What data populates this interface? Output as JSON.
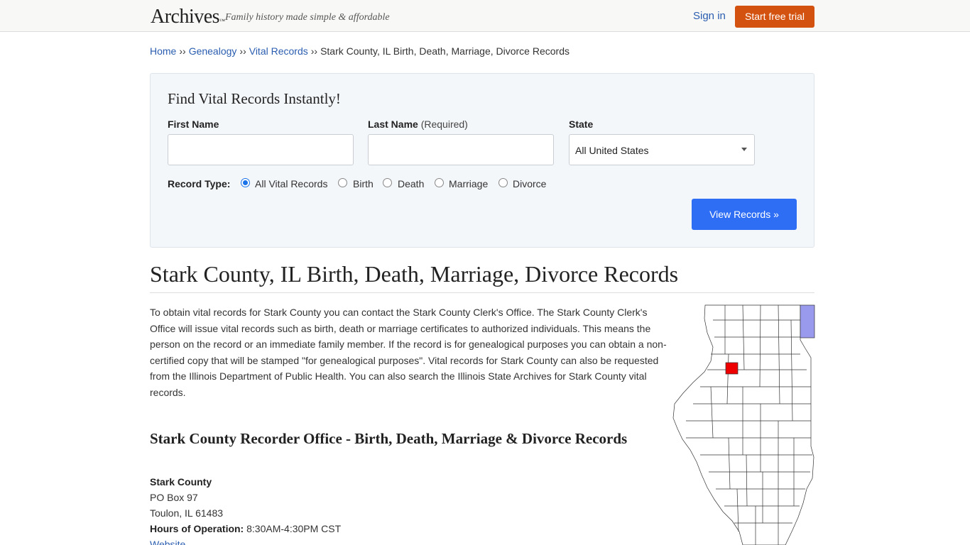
{
  "header": {
    "logo": "Archives",
    "logo_tm": "™",
    "tagline": "Family history made simple & affordable",
    "signin": "Sign in",
    "trial": "Start free trial"
  },
  "breadcrumb": {
    "items": [
      "Home",
      "Genealogy",
      "Vital Records"
    ],
    "separator": "››",
    "current": "Stark County, IL Birth, Death, Marriage, Divorce Records"
  },
  "search": {
    "title": "Find Vital Records Instantly!",
    "first_name_label": "First Name",
    "last_name_label": "Last Name",
    "last_name_required": "(Required)",
    "state_label": "State",
    "state_value": "All United States",
    "record_type_label": "Record Type:",
    "record_types": [
      "All Vital Records",
      "Birth",
      "Death",
      "Marriage",
      "Divorce"
    ],
    "selected_record_type": "All Vital Records",
    "submit": "View Records »"
  },
  "page_title": "Stark County, IL Birth, Death, Marriage, Divorce Records",
  "intro": "To obtain vital records for Stark County you can contact the Stark County Clerk's Office. The Stark County Clerk's Office will issue vital records such as birth, death or marriage certificates to authorized individuals. This means the person on the record or an immediate family member. If the record is for genealogical purposes you can obtain a non-certified copy that will be stamped \"for genealogical purposes\". Vital records for Stark County can also be requested from the Illinois Department of Public Health. You can also search the Illinois State Archives for Stark County vital records.",
  "section_title": "Stark County Recorder Office - Birth, Death, Marriage & Divorce Records",
  "office": {
    "name": "Stark County",
    "address1": "PO Box 97",
    "address2": "Toulon, IL 61483",
    "hours_label": "Hours of Operation:",
    "hours": "8:30AM-4:30PM CST",
    "website": "Website"
  },
  "colors": {
    "accent": "#2e6ef5",
    "trial": "#d4520f",
    "link": "#2a5db0",
    "highlight_county": "#ee0000",
    "lake": "#9999ee"
  }
}
